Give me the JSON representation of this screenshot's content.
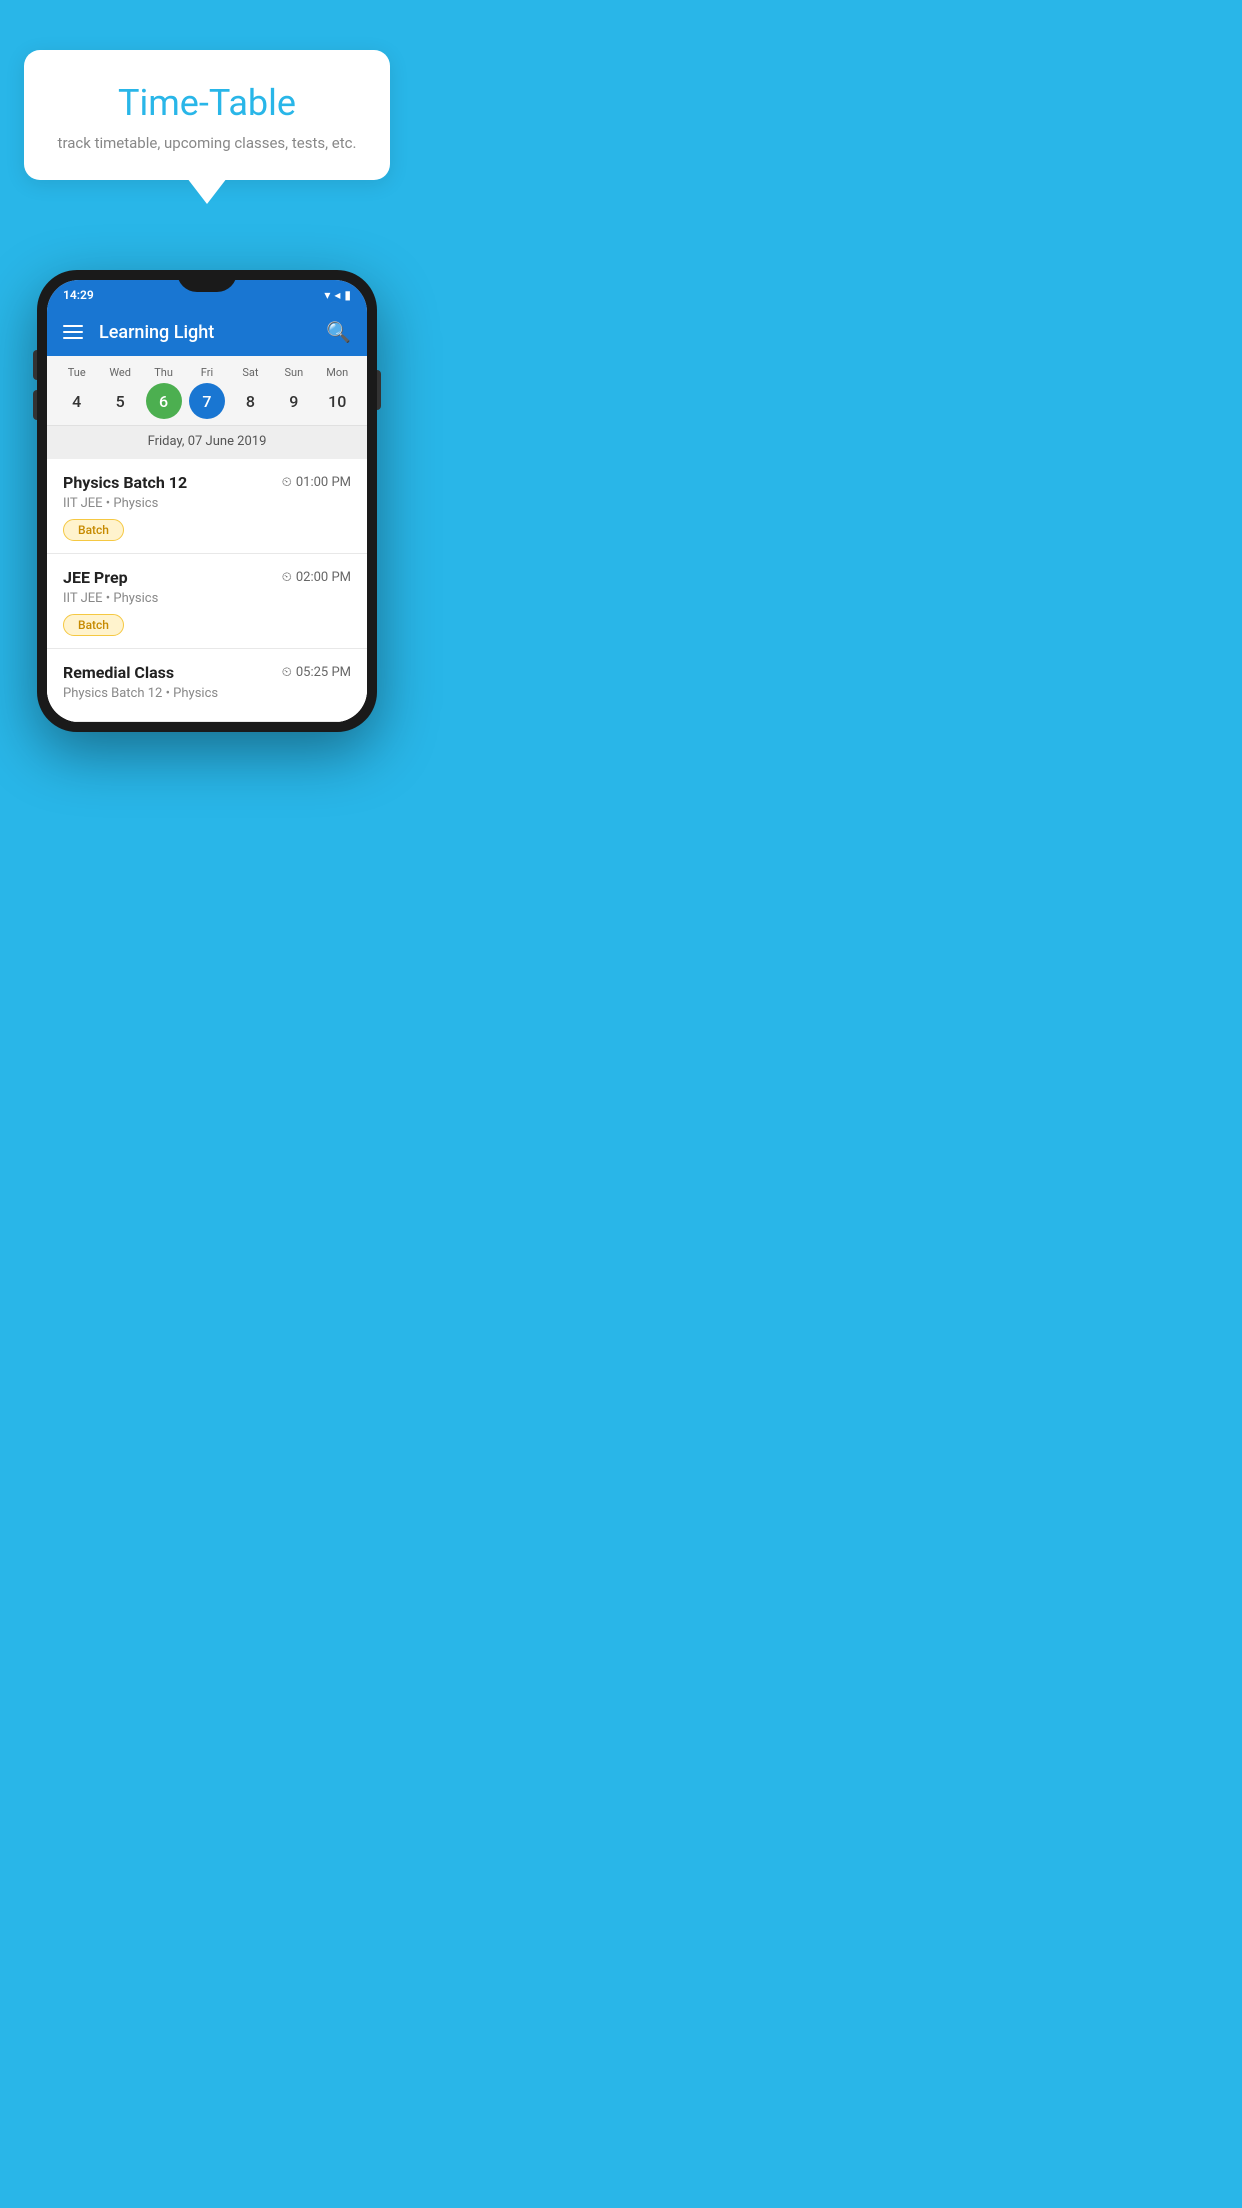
{
  "background_color": "#29B6E8",
  "bubble": {
    "title": "Time-Table",
    "subtitle": "track timetable, upcoming classes, tests, etc."
  },
  "phone": {
    "status_bar": {
      "time": "14:29",
      "icons": "▾◂▮"
    },
    "app_bar": {
      "title": "Learning Light"
    },
    "calendar": {
      "days": [
        {
          "name": "Tue",
          "number": "4",
          "state": "normal"
        },
        {
          "name": "Wed",
          "number": "5",
          "state": "normal"
        },
        {
          "name": "Thu",
          "number": "6",
          "state": "today"
        },
        {
          "name": "Fri",
          "number": "7",
          "state": "selected"
        },
        {
          "name": "Sat",
          "number": "8",
          "state": "normal"
        },
        {
          "name": "Sun",
          "number": "9",
          "state": "normal"
        },
        {
          "name": "Mon",
          "number": "10",
          "state": "normal"
        }
      ],
      "selected_date_label": "Friday, 07 June 2019"
    },
    "schedule": [
      {
        "title": "Physics Batch 12",
        "time": "01:00 PM",
        "subtitle": "IIT JEE • Physics",
        "badge": "Batch"
      },
      {
        "title": "JEE Prep",
        "time": "02:00 PM",
        "subtitle": "IIT JEE • Physics",
        "badge": "Batch"
      },
      {
        "title": "Remedial Class",
        "time": "05:25 PM",
        "subtitle": "Physics Batch 12 • Physics",
        "badge": null
      }
    ]
  }
}
